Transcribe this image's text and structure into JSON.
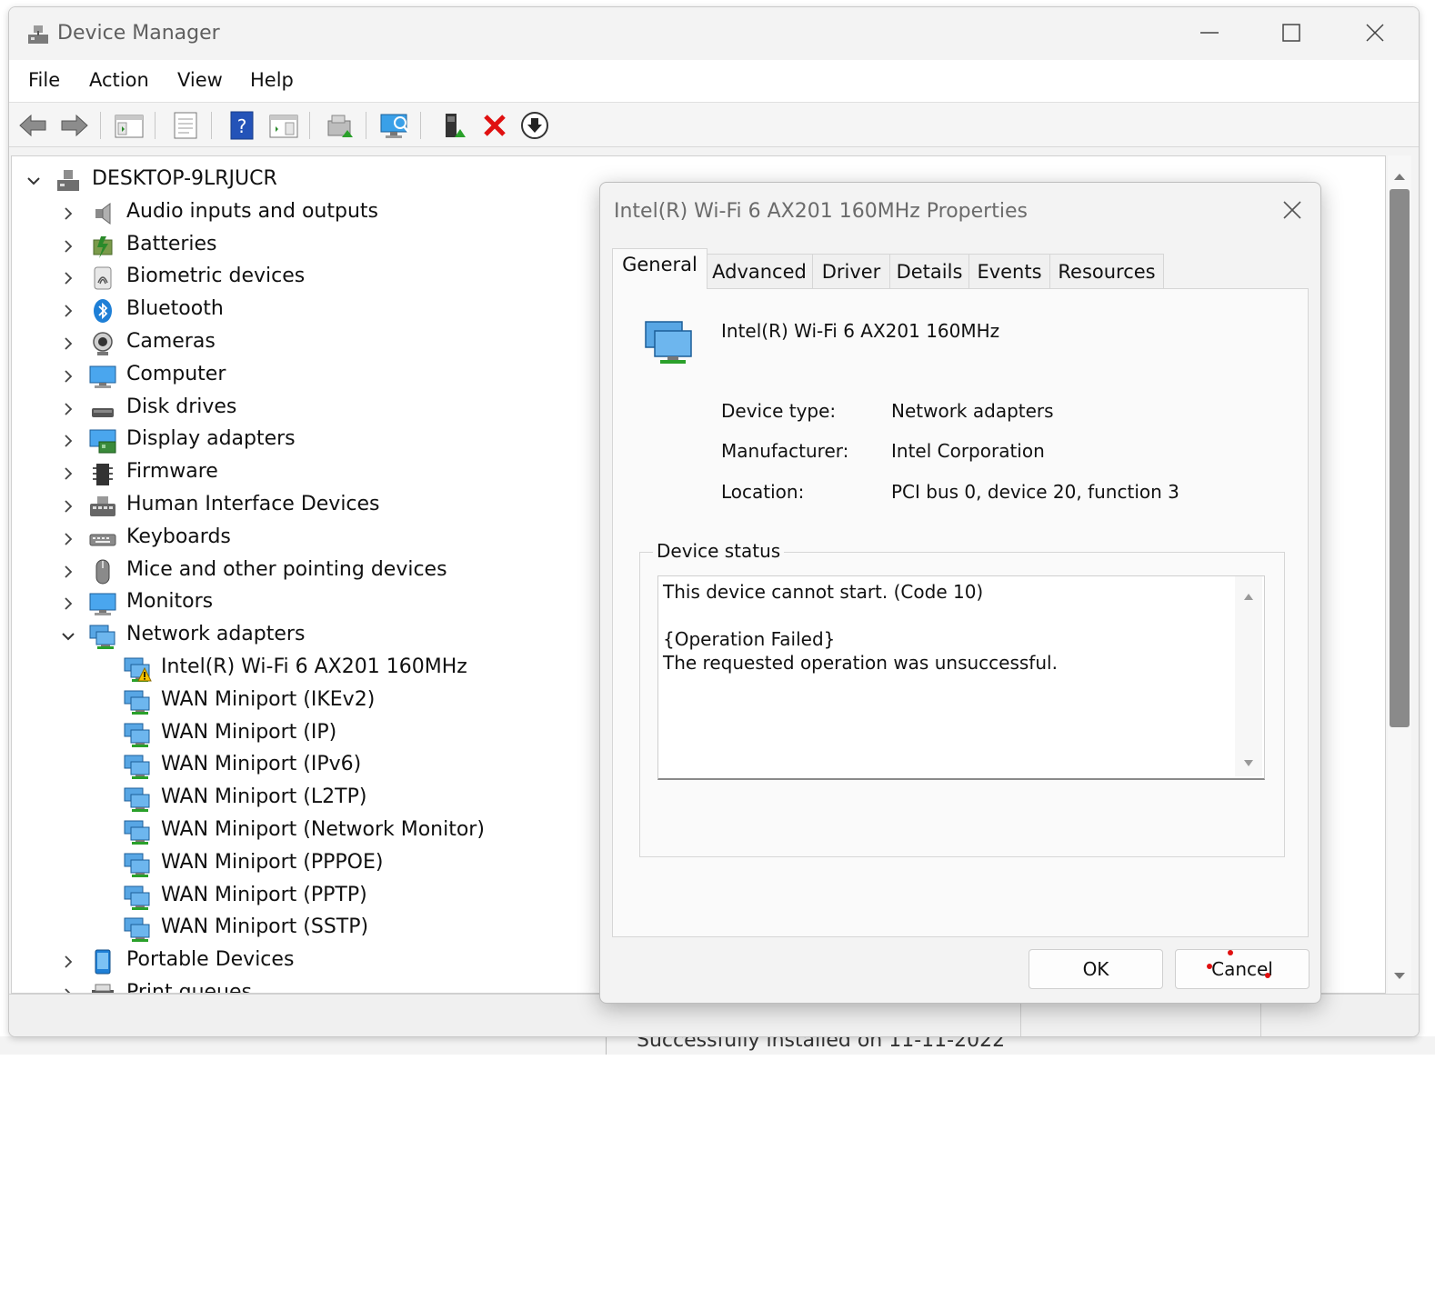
{
  "background": {
    "text": "Successfully installed on 11-11-2022"
  },
  "window": {
    "title": "Device Manager",
    "menu": [
      "File",
      "Action",
      "View",
      "Help"
    ],
    "toolbar_icons": [
      "back-arrow-icon",
      "forward-arrow-icon",
      "console-tree-icon",
      "properties-icon",
      "help-icon",
      "action-pane-icon",
      "update-driver-icon",
      "scan-hardware-icon",
      "enable-device-icon",
      "uninstall-device-icon",
      "download-driver-icon"
    ]
  },
  "tree": {
    "root": "DESKTOP-9LRJUCR",
    "categories": [
      {
        "label": "Audio inputs and outputs",
        "icon": "speaker-icon"
      },
      {
        "label": "Batteries",
        "icon": "battery-icon"
      },
      {
        "label": "Biometric devices",
        "icon": "fingerprint-icon"
      },
      {
        "label": "Bluetooth",
        "icon": "bluetooth-icon"
      },
      {
        "label": "Cameras",
        "icon": "camera-icon"
      },
      {
        "label": "Computer",
        "icon": "computer-icon"
      },
      {
        "label": "Disk drives",
        "icon": "disk-drive-icon"
      },
      {
        "label": "Display adapters",
        "icon": "display-adapter-icon"
      },
      {
        "label": "Firmware",
        "icon": "firmware-chip-icon"
      },
      {
        "label": "Human Interface Devices",
        "icon": "hid-icon"
      },
      {
        "label": "Keyboards",
        "icon": "keyboard-icon"
      },
      {
        "label": "Mice and other pointing devices",
        "icon": "mouse-icon"
      },
      {
        "label": "Monitors",
        "icon": "monitor-icon"
      },
      {
        "label": "Network adapters",
        "icon": "network-adapter-icon",
        "expanded": true
      }
    ],
    "network_children": [
      {
        "label": "Intel(R) Wi-Fi 6 AX201 160MHz",
        "warning": true
      },
      {
        "label": "WAN Miniport (IKEv2)"
      },
      {
        "label": "WAN Miniport (IP)"
      },
      {
        "label": "WAN Miniport (IPv6)"
      },
      {
        "label": "WAN Miniport (L2TP)"
      },
      {
        "label": "WAN Miniport (Network Monitor)"
      },
      {
        "label": "WAN Miniport (PPPOE)"
      },
      {
        "label": "WAN Miniport (PPTP)"
      },
      {
        "label": "WAN Miniport (SSTP)"
      }
    ],
    "after": [
      {
        "label": "Portable Devices",
        "icon": "portable-device-icon"
      },
      {
        "label": "Print queues",
        "icon": "printer-icon"
      }
    ]
  },
  "dialog": {
    "title": "Intel(R) Wi-Fi 6 AX201 160MHz Properties",
    "tabs": [
      "General",
      "Advanced",
      "Driver",
      "Details",
      "Events",
      "Resources"
    ],
    "active_tab": "General",
    "device_name": "Intel(R) Wi-Fi 6 AX201 160MHz",
    "properties": [
      {
        "label": "Device type:",
        "value": "Network adapters"
      },
      {
        "label": "Manufacturer:",
        "value": "Intel Corporation"
      },
      {
        "label": "Location:",
        "value": "PCI bus 0, device 20, function 3"
      }
    ],
    "status_group_label": "Device status",
    "status_lines": [
      "This device cannot start. (Code 10)",
      "",
      "{Operation Failed}",
      "The requested operation was unsuccessful."
    ],
    "ok_label": "OK",
    "cancel_label": "Cancel"
  },
  "colors": {
    "accent_blue": "#1e7fd6",
    "warning_yellow": "#f5c400",
    "error_red": "#e01010"
  }
}
